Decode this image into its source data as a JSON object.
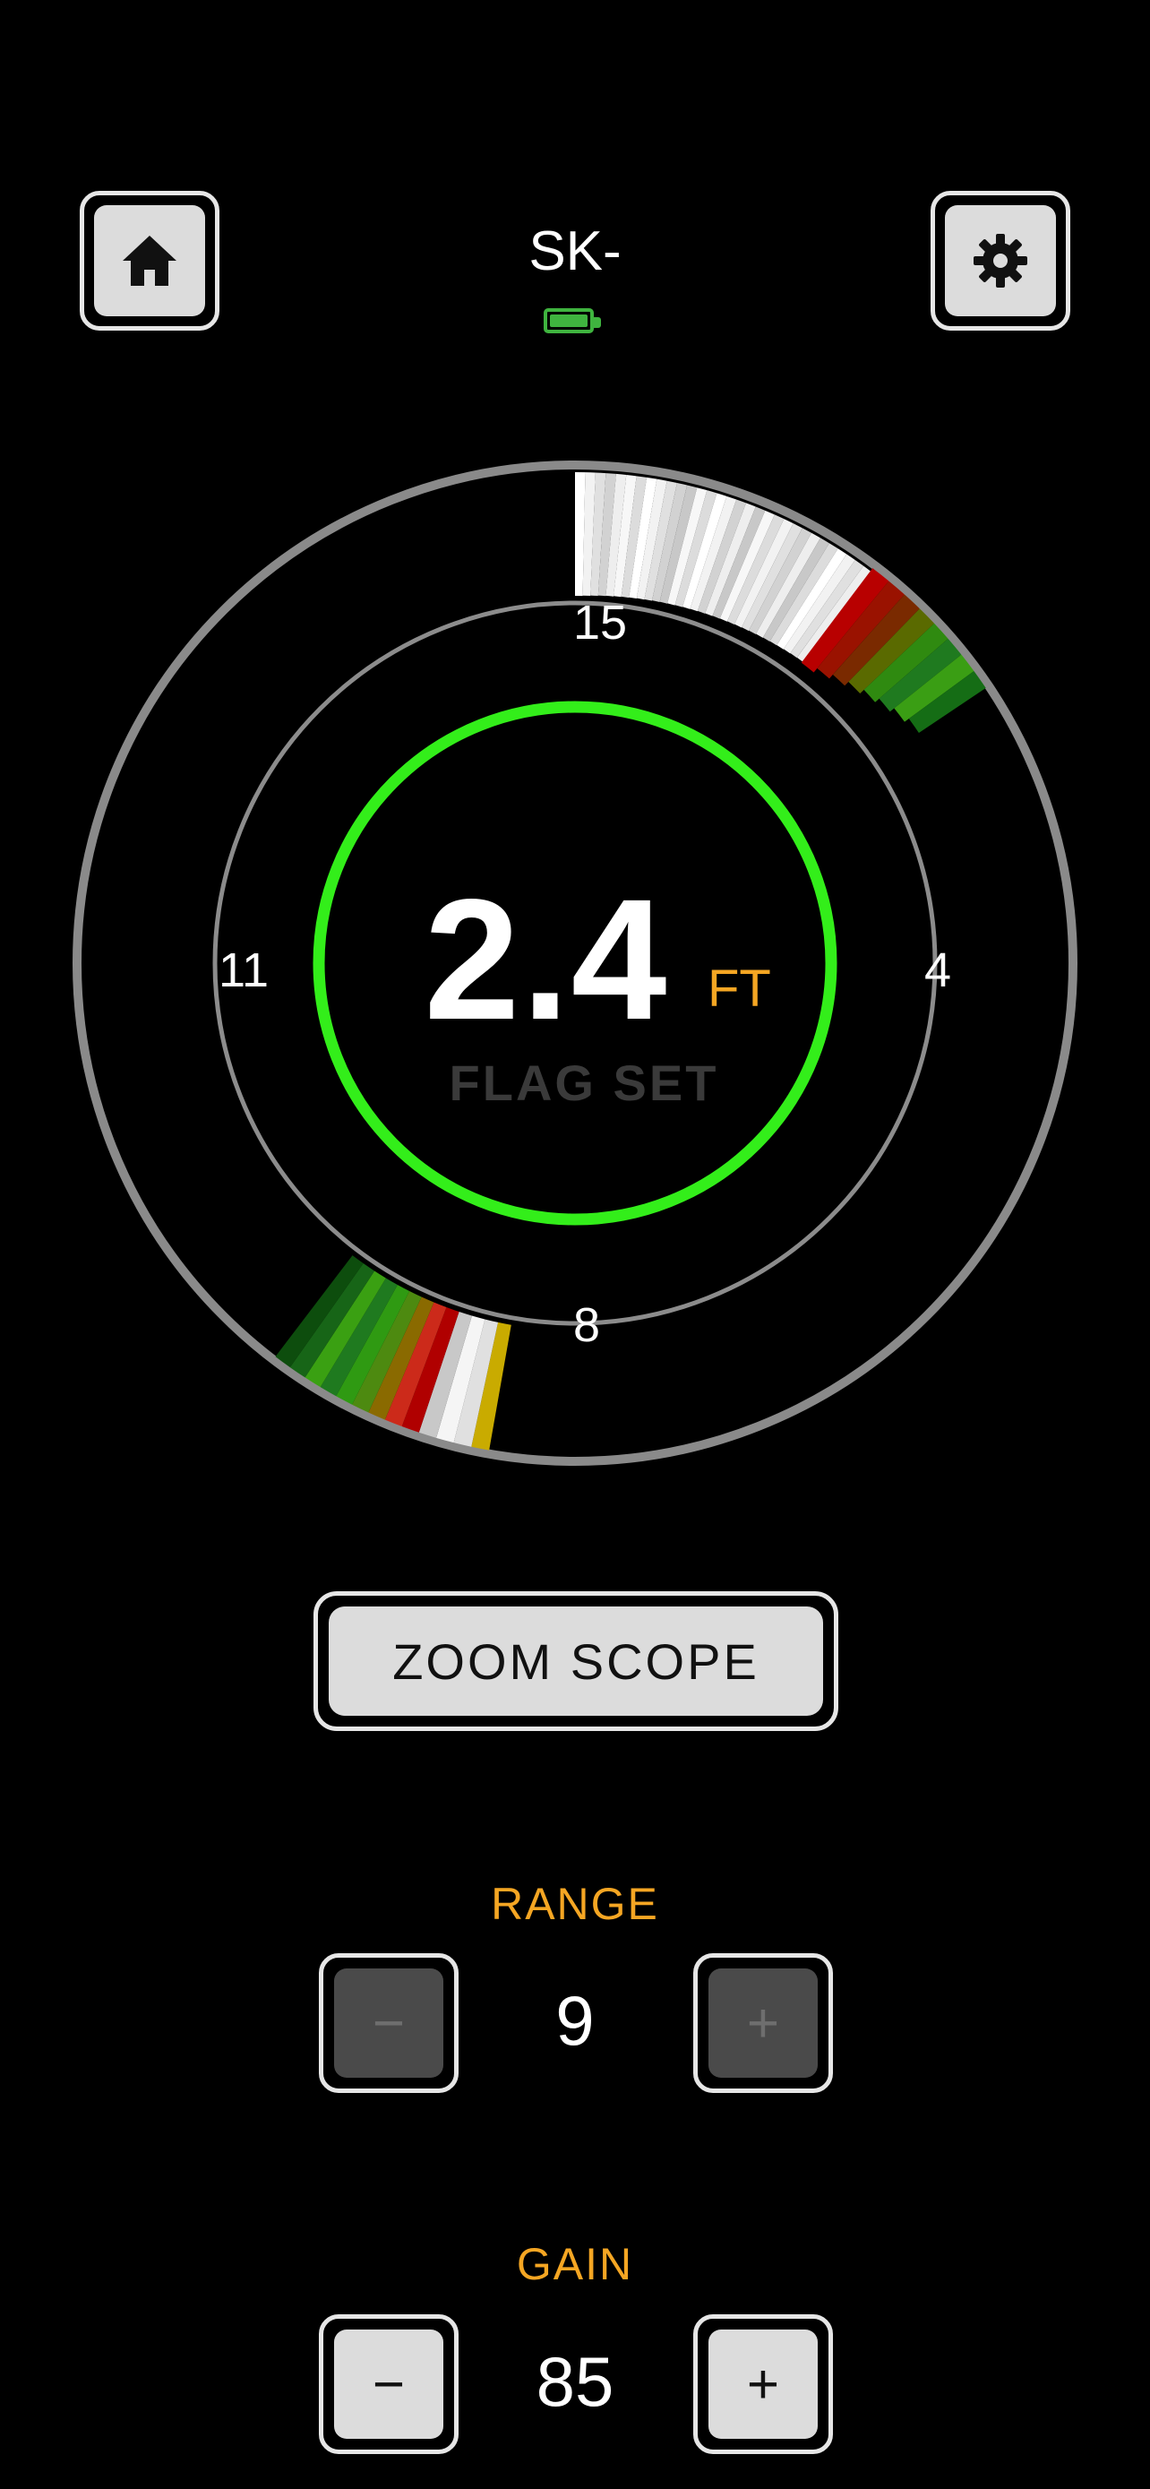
{
  "header": {
    "device_name": "SK-",
    "home_icon": "home-icon",
    "settings_icon": "gear-icon",
    "battery_icon": "battery-full-icon",
    "battery_color": "#3fb43f"
  },
  "scope": {
    "depth_value": "2.4",
    "depth_unit": "FT",
    "status_text": "FLAG SET",
    "tick_labels": {
      "top": "15",
      "right": "4",
      "bottom": "8",
      "left": "11"
    },
    "indicator_ring_color": "#33ee1a",
    "unit_color": "#f5a623"
  },
  "zoom_button": {
    "label": "ZOOM SCOPE"
  },
  "range": {
    "label": "RANGE",
    "value": "9",
    "minus": "−",
    "plus": "+",
    "disabled": true
  },
  "gain": {
    "label": "GAIN",
    "value": "85",
    "minus": "−",
    "plus": "+"
  },
  "accent_color": "#f5a623"
}
